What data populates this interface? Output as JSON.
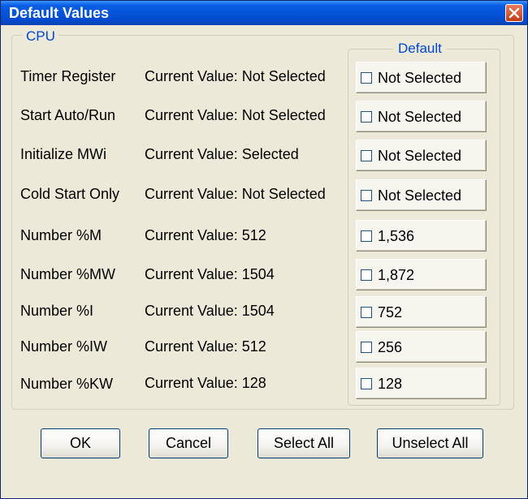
{
  "window": {
    "title": "Default Values"
  },
  "group": {
    "legend": "CPU"
  },
  "default_group": {
    "legend": "Default"
  },
  "rows": [
    {
      "label": "Timer Register",
      "current": "Current Value: Not Selected",
      "default": "Not Selected",
      "checked": false
    },
    {
      "label": "Start Auto/Run",
      "current": "Current Value: Not Selected",
      "default": "Not Selected",
      "checked": false
    },
    {
      "label": "Initialize MWi",
      "current": "Current Value: Selected",
      "default": "Not Selected",
      "checked": false
    },
    {
      "label": "Cold Start Only",
      "current": "Current Value: Not Selected",
      "default": "Not Selected",
      "checked": false
    },
    {
      "label": "Number %M",
      "current": "Current Value: 512",
      "default": "1,536",
      "checked": false
    },
    {
      "label": "Number %MW",
      "current": "Current Value: 1504",
      "default": "1,872",
      "checked": false
    },
    {
      "label": "Number %I",
      "current": "Current Value: 1504",
      "default": "752",
      "checked": false
    },
    {
      "label": "Number %IW",
      "current": "Current Value: 512",
      "default": "256",
      "checked": false
    },
    {
      "label": "Number %KW",
      "current": "Current Value: 128",
      "default": "128",
      "checked": false
    }
  ],
  "buttons": {
    "ok": "OK",
    "cancel": "Cancel",
    "select_all": "Select All",
    "unselect_all": "Unselect All"
  },
  "colors": {
    "title_bar": "#0453d8",
    "legend_text": "#0046d5",
    "dialog_bg": "#ece9d8",
    "close_button": "#c43b13"
  },
  "icons": {
    "close": "close-icon",
    "checkbox": "checkbox-icon"
  }
}
